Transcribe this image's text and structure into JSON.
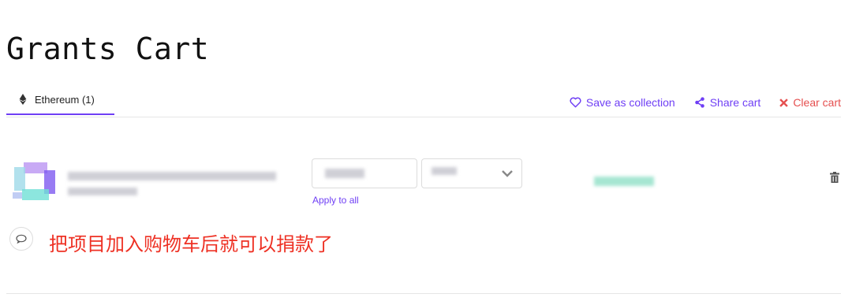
{
  "page": {
    "title": "Grants Cart"
  },
  "tabs": [
    {
      "label": "Ethereum (1)",
      "icon": "ethereum-icon"
    }
  ],
  "actions": {
    "save": {
      "label": "Save as collection",
      "icon": "heart-icon"
    },
    "share": {
      "label": "Share cart",
      "icon": "share-icon"
    },
    "clear": {
      "label": "Clear cart",
      "icon": "close-icon"
    }
  },
  "cart_item": {
    "apply_label": "Apply to all",
    "delete_icon": "trash-icon"
  },
  "annotation": {
    "text": "把项目加入购物车后就可以捐款了"
  },
  "colors": {
    "accent": "#6f3ff5",
    "danger": "#e54f4f",
    "annotation": "#ee3124"
  }
}
